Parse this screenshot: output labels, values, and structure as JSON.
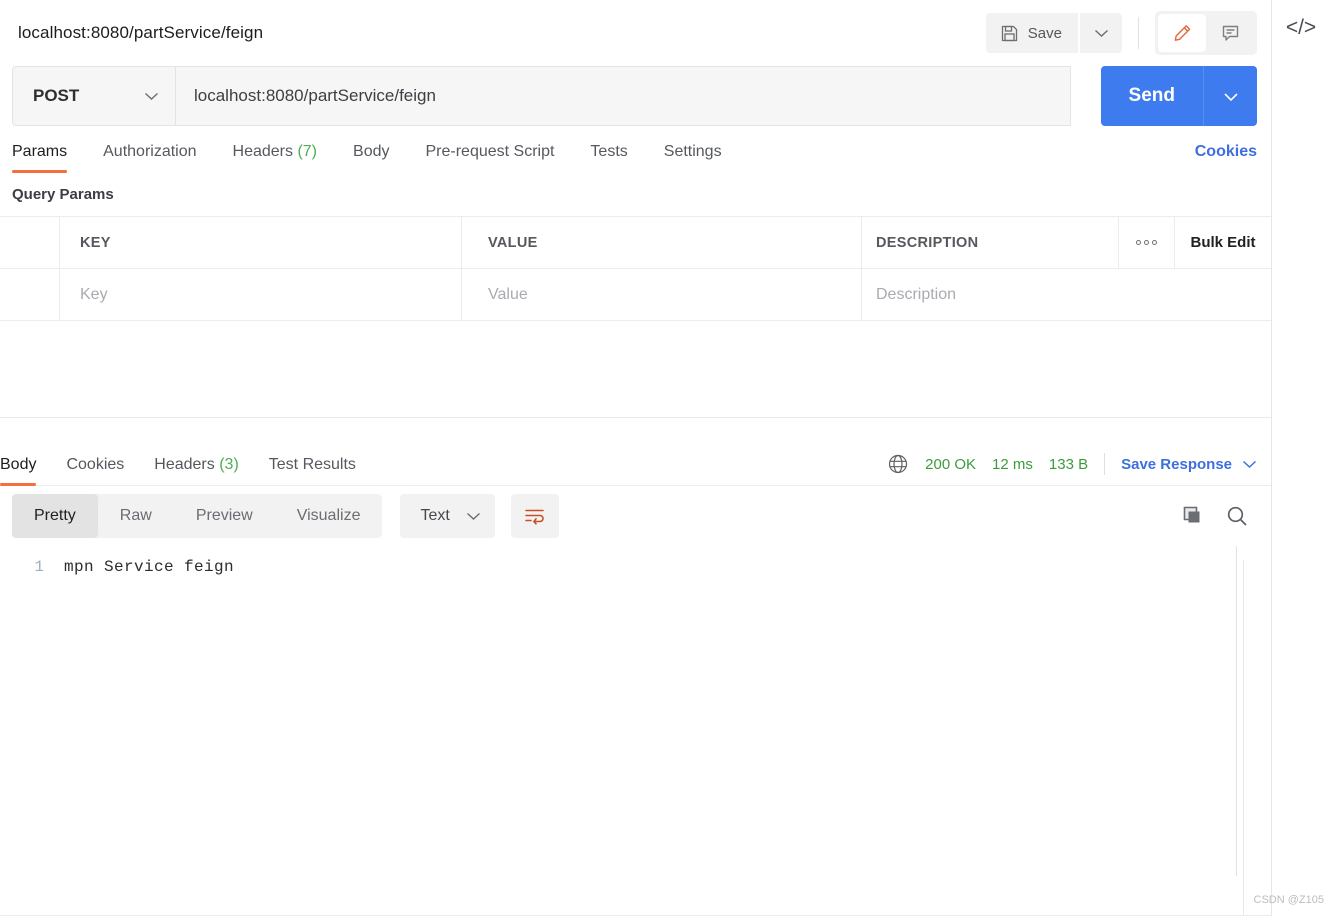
{
  "header": {
    "request_title": "localhost:8080/partService/feign",
    "save_label": "Save",
    "save_icon": "floppy-disk-icon",
    "save_caret_icon": "chevron-down-icon",
    "edit_icon": "pencil-icon",
    "comment_icon": "comment-icon",
    "code_icon": "</>"
  },
  "url_bar": {
    "method": "POST",
    "method_caret_icon": "chevron-down-icon",
    "url": "localhost:8080/partService/feign",
    "send_label": "Send",
    "send_caret_icon": "chevron-down-icon"
  },
  "request_tabs": {
    "items": [
      {
        "label": "Params",
        "count": "",
        "active": true
      },
      {
        "label": "Authorization",
        "count": "",
        "active": false
      },
      {
        "label": "Headers",
        "count": "(7)",
        "active": false
      },
      {
        "label": "Body",
        "count": "",
        "active": false
      },
      {
        "label": "Pre-request Script",
        "count": "",
        "active": false
      },
      {
        "label": "Tests",
        "count": "",
        "active": false
      },
      {
        "label": "Settings",
        "count": "",
        "active": false
      }
    ],
    "cookies_label": "Cookies"
  },
  "query_params": {
    "section_title": "Query Params",
    "columns": [
      "KEY",
      "VALUE",
      "DESCRIPTION"
    ],
    "more_icon": "three-dots-icon",
    "bulk_edit_label": "Bulk Edit",
    "rows": [
      {
        "key_placeholder": "Key",
        "value_placeholder": "Value",
        "description_placeholder": "Description"
      }
    ]
  },
  "response_tabs": {
    "items": [
      {
        "label": "Body",
        "count": "",
        "active": true
      },
      {
        "label": "Cookies",
        "count": "",
        "active": false
      },
      {
        "label": "Headers",
        "count": "(3)",
        "active": false
      },
      {
        "label": "Test Results",
        "count": "",
        "active": false
      }
    ],
    "globe_icon": "globe-icon",
    "status": "200 OK",
    "time": "12 ms",
    "size": "133 B",
    "save_response_label": "Save Response",
    "save_response_caret_icon": "chevron-down-icon"
  },
  "view_bar": {
    "modes": [
      {
        "label": "Pretty",
        "active": true
      },
      {
        "label": "Raw",
        "active": false
      },
      {
        "label": "Preview",
        "active": false
      },
      {
        "label": "Visualize",
        "active": false
      }
    ],
    "format": "Text",
    "format_caret_icon": "chevron-down-icon",
    "wrap_icon": "wrap-lines-icon",
    "copy_icon": "copy-icon",
    "search_icon": "search-icon"
  },
  "response_body": {
    "lines": [
      {
        "number": "1",
        "text": "mpn Service feign"
      }
    ]
  },
  "watermark": "CSDN @Z105",
  "colors": {
    "accent_orange": "#f2713b",
    "link_blue": "#3e6fe0",
    "send_blue": "#3e7bee",
    "status_green": "#3c9c3c",
    "count_green": "#4caf50"
  }
}
